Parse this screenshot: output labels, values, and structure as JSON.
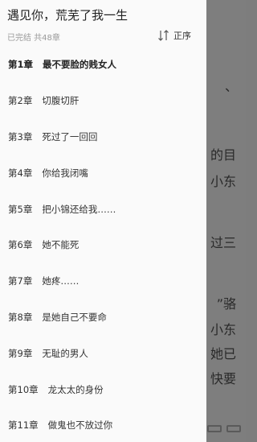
{
  "drawer": {
    "book_title": "遇见你，荒芜了我一生",
    "status": "已完结 共48章",
    "sort_label": "正序"
  },
  "chapters": [
    {
      "num": "第1章",
      "title": "最不要脸的贱女人"
    },
    {
      "num": "第2章",
      "title": "切腹切肝"
    },
    {
      "num": "第3章",
      "title": "死过了一回回"
    },
    {
      "num": "第4章",
      "title": "你给我闭嘴"
    },
    {
      "num": "第5章",
      "title": "把小锦还给我……"
    },
    {
      "num": "第6章",
      "title": "她不能死"
    },
    {
      "num": "第7章",
      "title": "她疼……"
    },
    {
      "num": "第8章",
      "title": "是她自己不要命"
    },
    {
      "num": "第9章",
      "title": "无耻的男人"
    },
    {
      "num": "第10章",
      "title": "龙太太的身份"
    },
    {
      "num": "第11章",
      "title": "做鬼也不放过你"
    }
  ],
  "reader_bg": {
    "fragments": [
      "、",
      "的目",
      "小东",
      "过三",
      "”骆",
      "小东",
      "她已",
      "快要"
    ]
  },
  "colors": {
    "drawer_bg": "#fafafa",
    "overlay_bg": "#7e7e7e",
    "text_primary": "#333333",
    "text_secondary": "#9a9a9a"
  }
}
